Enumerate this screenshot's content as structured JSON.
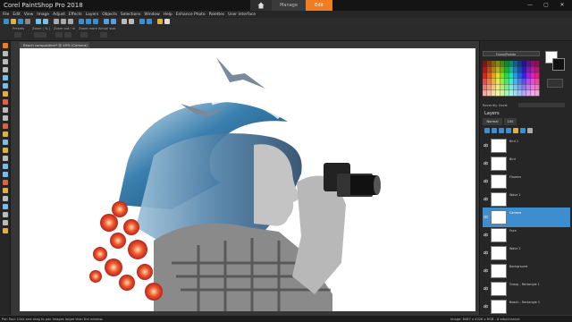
{
  "app": {
    "title": "Corel PaintShop Pro 2018"
  },
  "tabs": {
    "manage": "Manage",
    "edit": "Edit"
  },
  "window_controls": {
    "minimize": "—",
    "maximize": "▢",
    "close": "✕"
  },
  "menu": [
    "File",
    "Edit",
    "View",
    "Image",
    "Adjust",
    "Effects",
    "Layers",
    "Objects",
    "Selections",
    "Window",
    "Help",
    "Enhance Photo",
    "Palettes",
    "User Interface"
  ],
  "options_bar": {
    "presets_label": "Presets",
    "zoom_label": "Zoom ( % )",
    "zoom_out_label": "Zoom out / in",
    "zoom_more_label": "Zoom more",
    "actual_size_label": "Actual size"
  },
  "document": {
    "tab_label": "Beach composition* @ 49% (Camera)"
  },
  "materials": {
    "dropdown_label": "Frame/Palette"
  },
  "recent": {
    "label": "Recently Used:"
  },
  "layers": {
    "title": "Layers",
    "tab_normal": "Normal",
    "tab_opacity": "100",
    "items": [
      {
        "name": "Bird 1"
      },
      {
        "name": "Bird"
      },
      {
        "name": "Flowers"
      },
      {
        "name": "Wave 1"
      },
      {
        "name": "Camera"
      },
      {
        "name": "Face"
      },
      {
        "name": "Wave 2"
      },
      {
        "name": "Background"
      },
      {
        "name": "Group - Rectangle 1"
      },
      {
        "name": "Beach - Rectangle 1"
      }
    ],
    "selected_index": 4
  },
  "status": {
    "hint": "Pan Tool: Click and drag to pan images larger than the window.",
    "image_info": "Image: 6467 x 4328 x RGB - 8 bits/channel"
  },
  "colors": {
    "accent": "#f07d22",
    "selection": "#3c8ecf"
  }
}
